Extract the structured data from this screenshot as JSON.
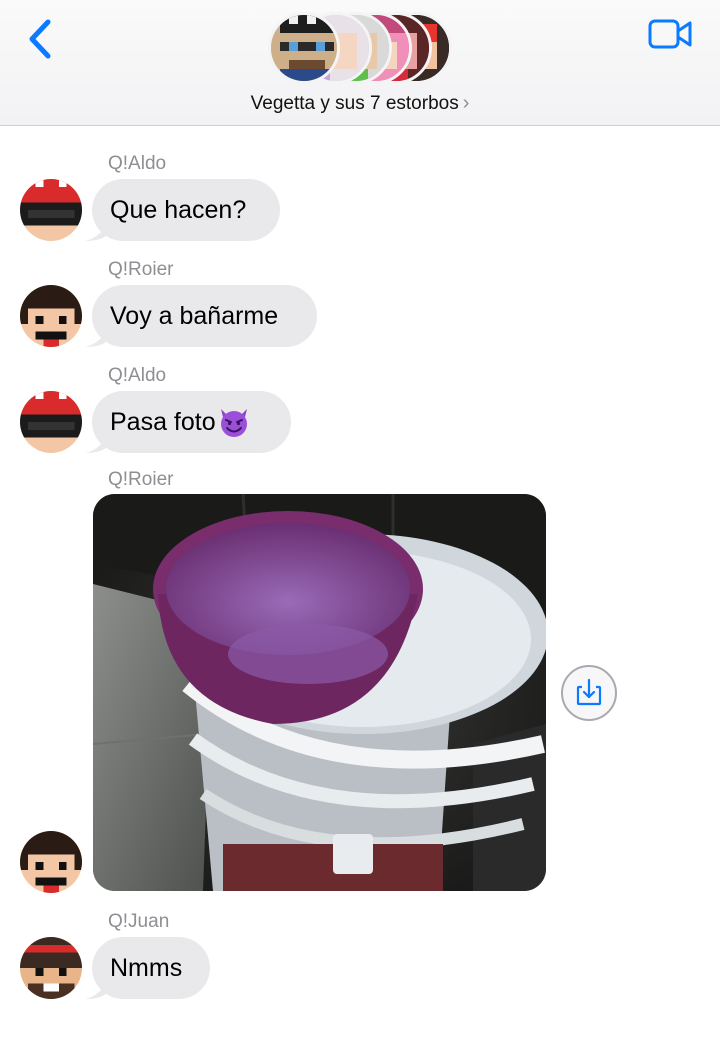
{
  "header": {
    "group_name": "Vegetta y sus 7 estorbos",
    "chevron": "›",
    "back_icon": "chevron-left-icon",
    "video_icon": "video-camera-icon"
  },
  "messages": [
    {
      "sender": "Q!Aldo",
      "text": "Que hacen?"
    },
    {
      "sender": "Q!Roier",
      "text": "Voy a bañarme"
    },
    {
      "sender": "Q!Aldo",
      "text": "Pasa foto",
      "emoji": "😈"
    },
    {
      "sender": "Q!Roier",
      "attachment": "photo",
      "action_icon": "save-download-icon"
    },
    {
      "sender": "Q!Juan",
      "text": "Nmms"
    }
  ],
  "colors": {
    "accent": "#0a7aff",
    "bubble": "#e9e9eb",
    "sender_label": "#8e8e93"
  }
}
